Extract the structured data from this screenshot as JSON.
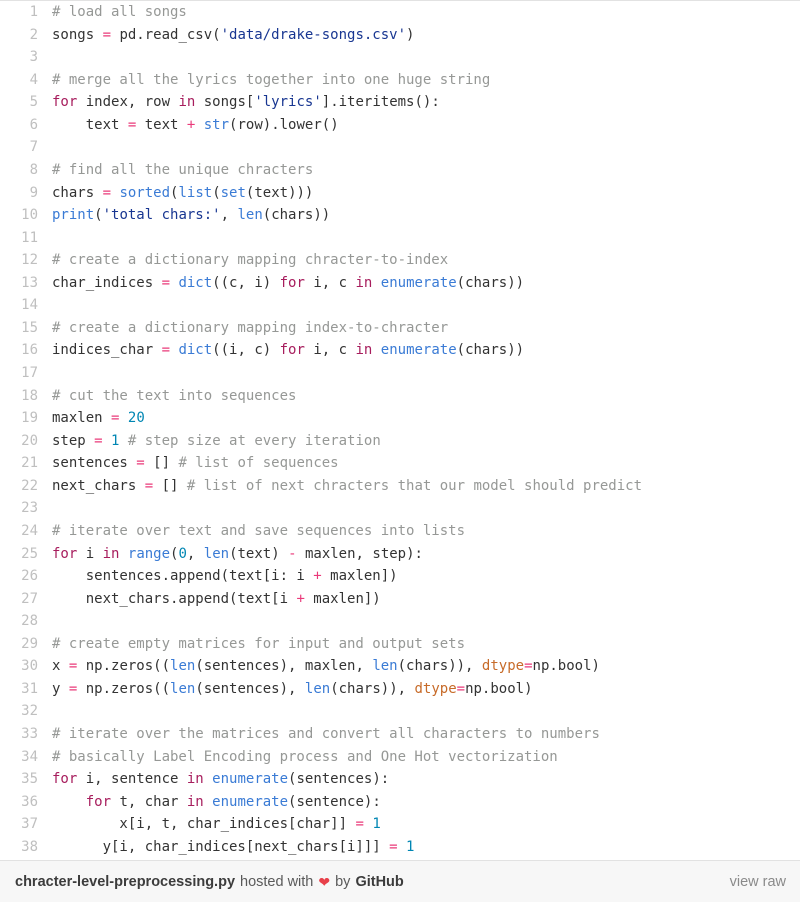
{
  "gist": {
    "language": "python",
    "theme": {
      "background": "#ffffff",
      "footer_background": "#f7f7f7",
      "border": "#e2e2e2",
      "line_number": "#bfbfbf",
      "plain_text": "#333333",
      "comment": "#969896",
      "keyword": "#a71d5d",
      "operator": "#ea3a7a",
      "string": "#183691",
      "number": "#0086b3",
      "builtin": "#3a7bd5",
      "kwarg": "#c76b29",
      "heart": "#e8404a"
    },
    "total_lines": 38,
    "lines": [
      {
        "n": "1",
        "tokens": [
          {
            "t": "c",
            "v": "# load all songs"
          }
        ]
      },
      {
        "n": "2",
        "tokens": [
          {
            "t": "p",
            "v": "songs "
          },
          {
            "t": "o",
            "v": "="
          },
          {
            "t": "p",
            "v": " pd.read_csv("
          },
          {
            "t": "s",
            "v": "'data/drake-songs.csv'"
          },
          {
            "t": "p",
            "v": ")"
          }
        ]
      },
      {
        "n": "3",
        "tokens": []
      },
      {
        "n": "4",
        "tokens": [
          {
            "t": "c",
            "v": "# merge all the lyrics together into one huge string"
          }
        ]
      },
      {
        "n": "5",
        "tokens": [
          {
            "t": "k",
            "v": "for"
          },
          {
            "t": "p",
            "v": " index, row "
          },
          {
            "t": "k",
            "v": "in"
          },
          {
            "t": "p",
            "v": " songs["
          },
          {
            "t": "s",
            "v": "'lyrics'"
          },
          {
            "t": "p",
            "v": "].iteritems():"
          }
        ]
      },
      {
        "n": "6",
        "tokens": [
          {
            "t": "p",
            "v": "    text "
          },
          {
            "t": "o",
            "v": "="
          },
          {
            "t": "p",
            "v": " text "
          },
          {
            "t": "o",
            "v": "+"
          },
          {
            "t": "p",
            "v": " "
          },
          {
            "t": "b",
            "v": "str"
          },
          {
            "t": "p",
            "v": "(row).lower()"
          }
        ]
      },
      {
        "n": "7",
        "tokens": []
      },
      {
        "n": "8",
        "tokens": [
          {
            "t": "c",
            "v": "# find all the unique chracters"
          }
        ]
      },
      {
        "n": "9",
        "tokens": [
          {
            "t": "p",
            "v": "chars "
          },
          {
            "t": "o",
            "v": "="
          },
          {
            "t": "p",
            "v": " "
          },
          {
            "t": "b",
            "v": "sorted"
          },
          {
            "t": "p",
            "v": "("
          },
          {
            "t": "b",
            "v": "list"
          },
          {
            "t": "p",
            "v": "("
          },
          {
            "t": "b",
            "v": "set"
          },
          {
            "t": "p",
            "v": "(text)))"
          }
        ]
      },
      {
        "n": "10",
        "tokens": [
          {
            "t": "b",
            "v": "print"
          },
          {
            "t": "p",
            "v": "("
          },
          {
            "t": "s",
            "v": "'total chars:'"
          },
          {
            "t": "p",
            "v": ", "
          },
          {
            "t": "b",
            "v": "len"
          },
          {
            "t": "p",
            "v": "(chars))"
          }
        ]
      },
      {
        "n": "11",
        "tokens": []
      },
      {
        "n": "12",
        "tokens": [
          {
            "t": "c",
            "v": "# create a dictionary mapping chracter-to-index"
          }
        ]
      },
      {
        "n": "13",
        "tokens": [
          {
            "t": "p",
            "v": "char_indices "
          },
          {
            "t": "o",
            "v": "="
          },
          {
            "t": "p",
            "v": " "
          },
          {
            "t": "b",
            "v": "dict"
          },
          {
            "t": "p",
            "v": "((c, i) "
          },
          {
            "t": "k",
            "v": "for"
          },
          {
            "t": "p",
            "v": " i, c "
          },
          {
            "t": "k",
            "v": "in"
          },
          {
            "t": "p",
            "v": " "
          },
          {
            "t": "b",
            "v": "enumerate"
          },
          {
            "t": "p",
            "v": "(chars))"
          }
        ]
      },
      {
        "n": "14",
        "tokens": []
      },
      {
        "n": "15",
        "tokens": [
          {
            "t": "c",
            "v": "# create a dictionary mapping index-to-chracter"
          }
        ]
      },
      {
        "n": "16",
        "tokens": [
          {
            "t": "p",
            "v": "indices_char "
          },
          {
            "t": "o",
            "v": "="
          },
          {
            "t": "p",
            "v": " "
          },
          {
            "t": "b",
            "v": "dict"
          },
          {
            "t": "p",
            "v": "((i, c) "
          },
          {
            "t": "k",
            "v": "for"
          },
          {
            "t": "p",
            "v": " i, c "
          },
          {
            "t": "k",
            "v": "in"
          },
          {
            "t": "p",
            "v": " "
          },
          {
            "t": "b",
            "v": "enumerate"
          },
          {
            "t": "p",
            "v": "(chars))"
          }
        ]
      },
      {
        "n": "17",
        "tokens": []
      },
      {
        "n": "18",
        "tokens": [
          {
            "t": "c",
            "v": "# cut the text into sequences"
          }
        ]
      },
      {
        "n": "19",
        "tokens": [
          {
            "t": "p",
            "v": "maxlen "
          },
          {
            "t": "o",
            "v": "="
          },
          {
            "t": "p",
            "v": " "
          },
          {
            "t": "n",
            "v": "20"
          }
        ]
      },
      {
        "n": "20",
        "tokens": [
          {
            "t": "p",
            "v": "step "
          },
          {
            "t": "o",
            "v": "="
          },
          {
            "t": "p",
            "v": " "
          },
          {
            "t": "n",
            "v": "1"
          },
          {
            "t": "p",
            "v": " "
          },
          {
            "t": "c",
            "v": "# step size at every iteration"
          }
        ]
      },
      {
        "n": "21",
        "tokens": [
          {
            "t": "p",
            "v": "sentences "
          },
          {
            "t": "o",
            "v": "="
          },
          {
            "t": "p",
            "v": " [] "
          },
          {
            "t": "c",
            "v": "# list of sequences"
          }
        ]
      },
      {
        "n": "22",
        "tokens": [
          {
            "t": "p",
            "v": "next_chars "
          },
          {
            "t": "o",
            "v": "="
          },
          {
            "t": "p",
            "v": " [] "
          },
          {
            "t": "c",
            "v": "# list of next chracters that our model should predict"
          }
        ]
      },
      {
        "n": "23",
        "tokens": []
      },
      {
        "n": "24",
        "tokens": [
          {
            "t": "c",
            "v": "# iterate over text and save sequences into lists"
          }
        ]
      },
      {
        "n": "25",
        "tokens": [
          {
            "t": "k",
            "v": "for"
          },
          {
            "t": "p",
            "v": " i "
          },
          {
            "t": "k",
            "v": "in"
          },
          {
            "t": "p",
            "v": " "
          },
          {
            "t": "b",
            "v": "range"
          },
          {
            "t": "p",
            "v": "("
          },
          {
            "t": "n",
            "v": "0"
          },
          {
            "t": "p",
            "v": ", "
          },
          {
            "t": "b",
            "v": "len"
          },
          {
            "t": "p",
            "v": "(text) "
          },
          {
            "t": "o",
            "v": "-"
          },
          {
            "t": "p",
            "v": " maxlen, step):"
          }
        ]
      },
      {
        "n": "26",
        "tokens": [
          {
            "t": "p",
            "v": "    sentences.append(text[i: i "
          },
          {
            "t": "o",
            "v": "+"
          },
          {
            "t": "p",
            "v": " maxlen])"
          }
        ]
      },
      {
        "n": "27",
        "tokens": [
          {
            "t": "p",
            "v": "    next_chars.append(text[i "
          },
          {
            "t": "o",
            "v": "+"
          },
          {
            "t": "p",
            "v": " maxlen])"
          }
        ]
      },
      {
        "n": "28",
        "tokens": []
      },
      {
        "n": "29",
        "tokens": [
          {
            "t": "c",
            "v": "# create empty matrices for input and output sets"
          }
        ]
      },
      {
        "n": "30",
        "tokens": [
          {
            "t": "p",
            "v": "x "
          },
          {
            "t": "o",
            "v": "="
          },
          {
            "t": "p",
            "v": " np.zeros(("
          },
          {
            "t": "b",
            "v": "len"
          },
          {
            "t": "p",
            "v": "(sentences), maxlen, "
          },
          {
            "t": "b",
            "v": "len"
          },
          {
            "t": "p",
            "v": "(chars)), "
          },
          {
            "t": "kw",
            "v": "dtype"
          },
          {
            "t": "o",
            "v": "="
          },
          {
            "t": "p",
            "v": "np.bool)"
          }
        ]
      },
      {
        "n": "31",
        "tokens": [
          {
            "t": "p",
            "v": "y "
          },
          {
            "t": "o",
            "v": "="
          },
          {
            "t": "p",
            "v": " np.zeros(("
          },
          {
            "t": "b",
            "v": "len"
          },
          {
            "t": "p",
            "v": "(sentences), "
          },
          {
            "t": "b",
            "v": "len"
          },
          {
            "t": "p",
            "v": "(chars)), "
          },
          {
            "t": "kw",
            "v": "dtype"
          },
          {
            "t": "o",
            "v": "="
          },
          {
            "t": "p",
            "v": "np.bool)"
          }
        ]
      },
      {
        "n": "32",
        "tokens": []
      },
      {
        "n": "33",
        "tokens": [
          {
            "t": "c",
            "v": "# iterate over the matrices and convert all characters to numbers"
          }
        ]
      },
      {
        "n": "34",
        "tokens": [
          {
            "t": "c",
            "v": "# basically Label Encoding process and One Hot vectorization"
          }
        ]
      },
      {
        "n": "35",
        "tokens": [
          {
            "t": "k",
            "v": "for"
          },
          {
            "t": "p",
            "v": " i, sentence "
          },
          {
            "t": "k",
            "v": "in"
          },
          {
            "t": "p",
            "v": " "
          },
          {
            "t": "b",
            "v": "enumerate"
          },
          {
            "t": "p",
            "v": "(sentences):"
          }
        ]
      },
      {
        "n": "36",
        "tokens": [
          {
            "t": "p",
            "v": "    "
          },
          {
            "t": "k",
            "v": "for"
          },
          {
            "t": "p",
            "v": " t, char "
          },
          {
            "t": "k",
            "v": "in"
          },
          {
            "t": "p",
            "v": " "
          },
          {
            "t": "b",
            "v": "enumerate"
          },
          {
            "t": "p",
            "v": "(sentence):"
          }
        ]
      },
      {
        "n": "37",
        "tokens": [
          {
            "t": "p",
            "v": "        x[i, t, char_indices[char]] "
          },
          {
            "t": "o",
            "v": "="
          },
          {
            "t": "p",
            "v": " "
          },
          {
            "t": "n",
            "v": "1"
          }
        ]
      },
      {
        "n": "38",
        "tokens": [
          {
            "t": "p",
            "v": "      y[i, char_indices[next_chars[i]]] "
          },
          {
            "t": "o",
            "v": "="
          },
          {
            "t": "p",
            "v": " "
          },
          {
            "t": "n",
            "v": "1"
          }
        ]
      }
    ]
  },
  "footer": {
    "filename": "chracter-level-preprocessing.py",
    "hosted_with": "hosted with",
    "heart_icon": "heart-icon",
    "heart_glyph": "❤",
    "by": "by",
    "provider": "GitHub",
    "view_raw": "view raw"
  }
}
